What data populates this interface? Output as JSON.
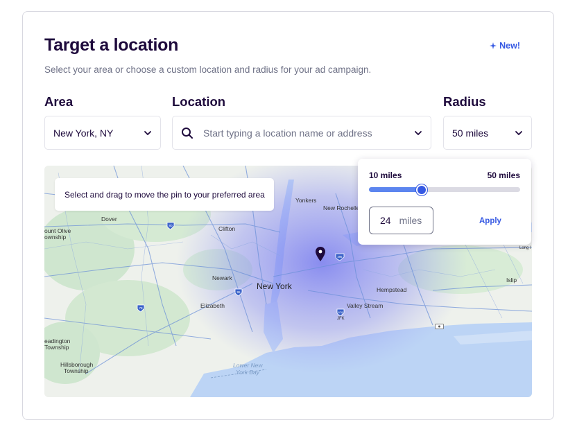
{
  "header": {
    "title": "Target a location",
    "new_badge": "New!",
    "subtitle": "Select your area or choose a custom location and radius for your ad campaign."
  },
  "fields": {
    "area_label": "Area",
    "area_value": "New York, NY",
    "location_label": "Location",
    "location_placeholder": "Start typing a location name  or address",
    "radius_label": "Radius",
    "radius_value": "50 miles"
  },
  "map": {
    "hint": "Select and drag to move the pin to your preferred area",
    "labels": {
      "dover": "Dover",
      "mount_olive": "ount Olive",
      "township1": "ownship",
      "clifton": "Clifton",
      "yonkers": "Yonkers",
      "new_rochelle": "New Rochelle",
      "newark": "Newark",
      "new_york": "New York",
      "elizabeth": "Elizabeth",
      "hempstead": "Hempstead",
      "valley_stream": "Valley Stream",
      "jfk": "JFK",
      "islip": "Islip",
      "long_is": "Long I",
      "readington": "eadington",
      "township2": "Township",
      "hillsborough": "Hillsborough",
      "township3": "Township",
      "lower_ny": "Lower New",
      "york_bay": "York Bay"
    },
    "shields": {
      "i80": "80",
      "i78": "78",
      "i95": "95",
      "i678": "678",
      "i495": "495"
    }
  },
  "radius_popup": {
    "min_label": "10 miles",
    "max_label": "50 miles",
    "slider_fraction": 0.35,
    "input_value": "24",
    "input_unit": "miles",
    "apply_label": "Apply"
  },
  "colors": {
    "accent": "#3659e3",
    "title": "#1e0a3c",
    "muted": "#6f7287",
    "radius_overlay": "#6f73f0"
  }
}
